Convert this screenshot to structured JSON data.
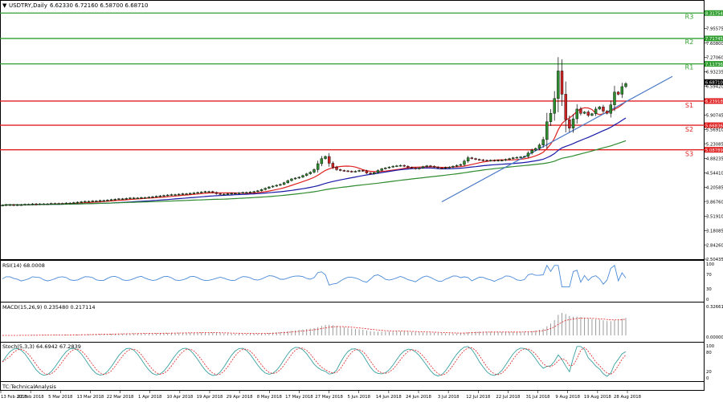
{
  "header": {
    "title": "USDTRY,Daily",
    "ohlc": "6.62330 6.72160 6.58700 6.68710",
    "menu_icon": "triangle-down-icon"
  },
  "panels": {
    "rsi_label": "RSI(14) 68.0008",
    "macd_label": "MACD(15,26,9) 0.235480 0.217114",
    "stoch_label": "Stoch(5,3,3) 64.6942 67.2839",
    "footer": "TC:TechnicalAnalysis"
  },
  "colors": {
    "candle_up": "#2e8b2e",
    "candle_down": "#cc2222",
    "ma_fast": "#e02020",
    "ma_mid": "#1a1aa8",
    "ma_slow": "#2e8b2e",
    "trendline": "#4a78c8",
    "resistance": "#2e9e2e",
    "support": "#e02020",
    "rsi": "#4a8ad8",
    "macd_hist": "#9a9a9a",
    "macd_signal": "#e02020",
    "stoch_main": "#3aa0a0",
    "stoch_signal": "#e02020"
  },
  "chart_data": {
    "type": "candlestick",
    "symbol": "USDTRY",
    "timeframe": "Daily",
    "ylim": [
      2.50435,
      8.55
    ],
    "y_ticks": [
      "8.31754",
      "7.95575",
      "7.71745",
      "7.60800",
      "7.27060",
      "7.11736",
      "6.93235",
      "6.68710",
      "6.59420",
      "6.23918",
      "5.90745",
      "5.66836",
      "5.56910",
      "5.23085",
      "5.08789",
      "4.88235",
      "4.54410",
      "4.20585",
      "3.86760",
      "3.51910",
      "3.18085",
      "2.84260",
      "2.50435"
    ],
    "x_labels": [
      "13 Feb 2018",
      "22 Feb 2018",
      "5 Mar 2018",
      "13 Mar 2018",
      "22 Mar 2018",
      "1 Apr 2018",
      "10 Apr 2018",
      "19 Apr 2018",
      "29 Apr 2018",
      "8 May 2018",
      "17 May 2018",
      "27 May 2018",
      "5 Jun 2018",
      "14 Jun 2018",
      "24 Jun 2018",
      "3 Jul 2018",
      "12 Jul 2018",
      "22 Jul 2018",
      "31 Jul 2018",
      "9 Aug 2018",
      "19 Aug 2018",
      "28 Aug 2018"
    ],
    "closes": [
      3.78,
      3.79,
      3.79,
      3.78,
      3.79,
      3.79,
      3.8,
      3.8,
      3.81,
      3.8,
      3.81,
      3.81,
      3.81,
      3.82,
      3.82,
      3.82,
      3.82,
      3.83,
      3.83,
      3.84,
      3.85,
      3.86,
      3.87,
      3.87,
      3.88,
      3.88,
      3.89,
      3.89,
      3.9,
      3.91,
      3.92,
      3.93,
      3.93,
      3.94,
      3.95,
      3.95,
      3.95,
      3.96,
      3.96,
      3.97,
      3.98,
      3.99,
      4.0,
      4.01,
      4.02,
      4.03,
      4.03,
      4.04,
      4.05,
      4.05,
      4.06,
      4.07,
      4.08,
      4.09,
      4.1,
      4.1,
      4.08,
      4.05,
      4.04,
      4.04,
      4.05,
      4.06,
      4.06,
      4.07,
      4.08,
      4.08,
      4.09,
      4.1,
      4.12,
      4.15,
      4.18,
      4.21,
      4.23,
      4.25,
      4.27,
      4.31,
      4.36,
      4.4,
      4.42,
      4.44,
      4.48,
      4.52,
      4.56,
      4.62,
      4.76,
      4.88,
      4.93,
      4.77,
      4.68,
      4.62,
      4.6,
      4.59,
      4.58,
      4.57,
      4.58,
      4.6,
      4.59,
      4.54,
      4.52,
      4.55,
      4.6,
      4.64,
      4.66,
      4.68,
      4.7,
      4.71,
      4.72,
      4.7,
      4.67,
      4.66,
      4.64,
      4.66,
      4.69,
      4.71,
      4.7,
      4.68,
      4.66,
      4.65,
      4.67,
      4.68,
      4.7,
      4.72,
      4.74,
      4.82,
      4.9,
      4.88,
      4.86,
      4.85,
      4.84,
      4.83,
      4.84,
      4.83,
      4.84,
      4.84,
      4.86,
      4.88,
      4.9,
      4.91,
      4.92,
      4.93,
      5.01,
      5.08,
      5.12,
      5.2,
      5.33,
      5.75,
      5.95,
      6.3,
      6.95,
      6.4,
      5.8,
      5.6,
      5.82,
      6.05,
      5.95,
      5.98,
      5.9,
      5.94,
      6.05,
      6.1,
      6.0,
      5.95,
      6.15,
      6.45,
      6.4,
      6.58,
      6.65
    ],
    "pivot_levels": [
      {
        "name": "R3",
        "value": 8.31754,
        "price": "8.31754"
      },
      {
        "name": "R2",
        "value": 7.71745,
        "price": "7.71745"
      },
      {
        "name": "R1",
        "value": 7.11736,
        "price": "7.11736"
      },
      {
        "name": "S1",
        "value": 6.23918,
        "price": "6.23918"
      },
      {
        "name": "S2",
        "value": 5.66836,
        "price": "5.66836"
      },
      {
        "name": "S3",
        "value": 5.08789,
        "price": "5.08789"
      }
    ],
    "last_price": "6.68710",
    "rsi": {
      "value": 68.0008,
      "levels": [
        100,
        70,
        30,
        0
      ]
    },
    "macd": {
      "main": 0.23548,
      "signal": 0.217114,
      "ticks": [
        "0.326611",
        "0.000000"
      ]
    },
    "stoch": {
      "main": 64.6942,
      "signal": 67.2839,
      "levels": [
        100,
        80,
        20,
        0
      ]
    }
  }
}
